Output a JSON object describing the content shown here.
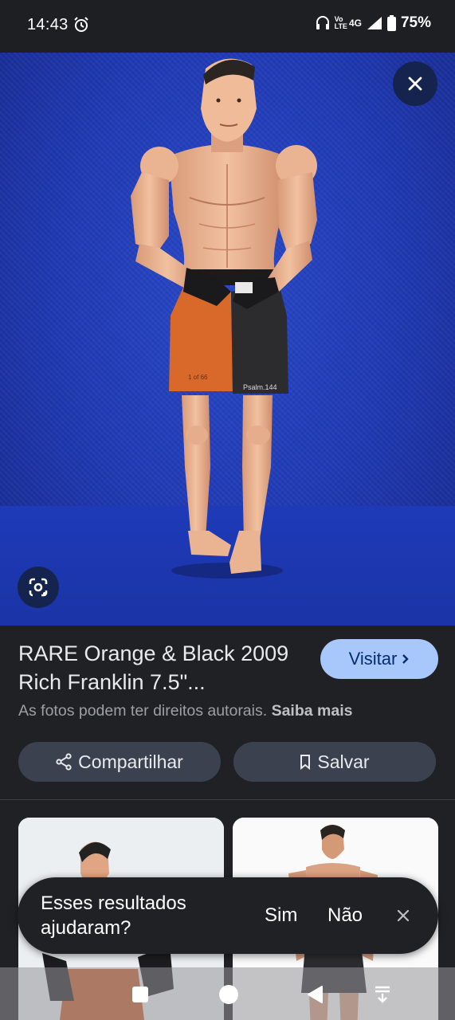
{
  "status_bar": {
    "time": "14:43",
    "network_top": "Vo",
    "network_bottom": "LTE",
    "network_type": "4G",
    "battery": "75%",
    "icons": [
      "alarm-icon",
      "headphones-icon",
      "signal-icon",
      "battery-icon"
    ]
  },
  "image_viewer": {
    "close_icon": "close-icon",
    "lens_icon": "lens-icon",
    "background_color": "#1f39b2"
  },
  "result": {
    "title": "RARE Orange & Black 2009 Rich Franklin 7.5\"...",
    "visit_label": "Visitar",
    "copyright_text": "As fotos podem ter direitos autorais.",
    "learn_more": "Saiba mais",
    "share_label": "Compartilhar",
    "save_label": "Salvar"
  },
  "feedback": {
    "question": "Esses resultados ajudaram?",
    "yes": "Sim",
    "no": "Não"
  },
  "colors": {
    "accent": "#a8c7fa",
    "pill_bg": "#3c4150",
    "surface": "#202124"
  }
}
